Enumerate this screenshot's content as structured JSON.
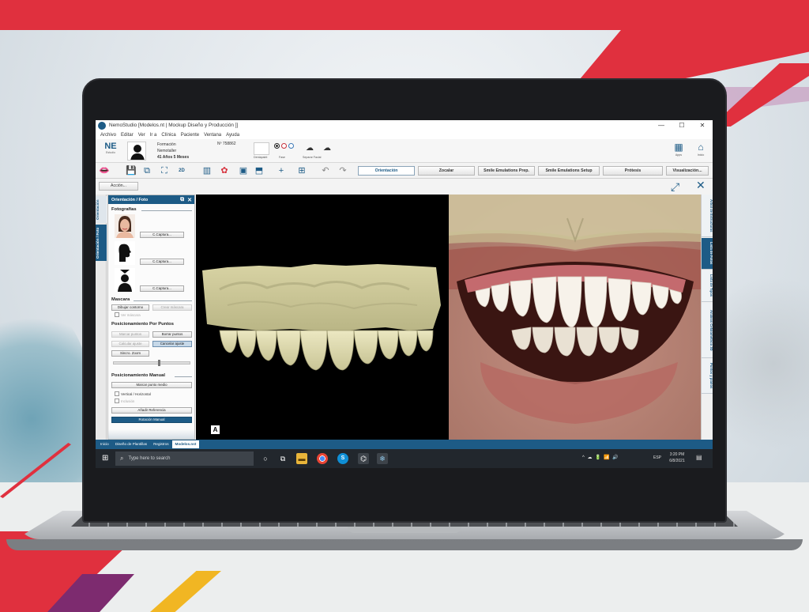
{
  "window": {
    "title": "NemoStudio  [Modelos.nt | Mockup  Diseño y Producción ]]",
    "controls": [
      "—",
      "☐",
      "✕"
    ]
  },
  "menu": [
    "Archivo",
    "Editar",
    "Ver",
    "Ir a",
    "Clínica",
    "Paciente",
    "Ventana",
    "Ayuda"
  ],
  "patient": {
    "initials": "NE",
    "initials_sub": "Estudio",
    "first_name": "Formación",
    "last_name": "Nemotaller",
    "age": "41 Años 5 Meses",
    "number": "Nº 758862",
    "box_label": "Dentapaint",
    "radios_label": "Fase",
    "cloud_label": "Separar Facial",
    "apps_label": "Apps",
    "home_label": "Inicio"
  },
  "toolbar": {
    "tabs": [
      "Orientación",
      "Zocalar",
      "Smile Emulations Prep.",
      "Smile Emulations Setup",
      "Prótesis",
      "Visualización..."
    ],
    "active_tab": "Orientación",
    "twod_label": "2D"
  },
  "action_button": "Acción...",
  "left_vtabs": [
    "Orientación",
    "Orientación / Foto"
  ],
  "panel": {
    "title": "Orientación / Foto",
    "sec_photos": "Fotografías",
    "capture": "C.Captura...",
    "sec_mask": "Mascara",
    "btn_draw_outline": "Dibujar contorno",
    "btn_create_mask": "Crear máscara",
    "chk_see_mask": "Ver máscara",
    "sec_points": "Posicionamiento Por Puntos",
    "btn_mark_points": "Marcar puntos",
    "btn_delete_points": "Borrar puntos",
    "btn_calculate": "Calcular ajuste",
    "btn_cancel_adjust": "Cancelar ajuste",
    "btn_sync_zoom": "Sincro. Zoom",
    "sec_manual": "Posicionamiento Manual",
    "btn_mark_mid": "Marcar punto medio",
    "chk_vertical": "Vertical / Horizontal",
    "chk_inclusion": "Inclusión",
    "btn_add_reference": "Añadir Referencia",
    "btn_manual_rotation": "Rotación Manual"
  },
  "viewport": {
    "label": "A"
  },
  "right_vtabs": [
    "Árbol de Estructuras",
    "Lista de Fotos",
    "Lista de Tipos",
    "Análisis Cefalométrico 3D",
    "Puntos y planos"
  ],
  "right_active": "Lista de Fotos",
  "bottom_tabs": [
    "Inicio",
    "Diseño de Plantillas",
    "Registros",
    "Modelos.nst"
  ],
  "bottom_active": "Modelos.nst",
  "taskbar": {
    "search_placeholder": "Type here to search",
    "tray": "^ ☁ 🔋 📶 🔊",
    "lang": "ESP",
    "time": "3:20 PM",
    "date": "6/8/2021"
  },
  "colors": {
    "brand_blue": "#1d5b86",
    "accent_red": "#e0303e",
    "purple": "#7d2b6f",
    "yellow": "#f1b623"
  }
}
